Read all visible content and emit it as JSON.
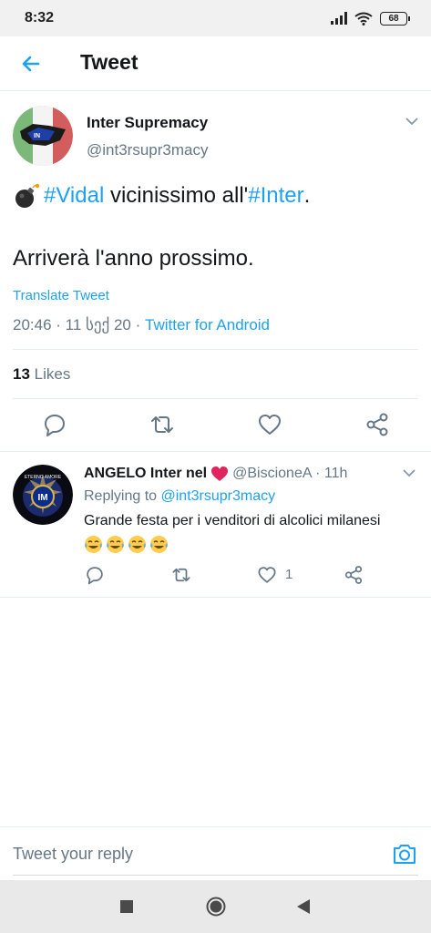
{
  "status_bar": {
    "time": "8:32",
    "battery": "68",
    "icons": [
      "signal-icon",
      "wifi-icon",
      "battery-icon"
    ]
  },
  "header": {
    "title": "Tweet",
    "back_icon": "arrow-left-icon"
  },
  "tweet": {
    "author_name": "Inter Supremacy",
    "author_handle": "@int3rsupr3macy",
    "text_emoji": "bomb-emoji",
    "text_tag1": "#Vidal",
    "text_mid": " vicinissimo all'",
    "text_tag2": "#Inter",
    "text_end": ".",
    "text_line2": "Arriverà l'anno prossimo.",
    "translate_label": "Translate Tweet",
    "timestamp": "20:46 · 11 სექ 20 · ",
    "source": "Twitter for Android",
    "likes_count": "13",
    "likes_label": " Likes",
    "actions": [
      "reply-icon",
      "retweet-icon",
      "like-icon",
      "share-icon"
    ]
  },
  "reply": {
    "name": "ANGELO Inter nel",
    "name_emoji": "red-heart-emoji",
    "handle": "@BiscioneA · 11h",
    "replying_prefix": "Replying to ",
    "replying_to": "@int3rsupr3macy",
    "text": "Grande festa per i venditori di alcolici milanesi",
    "emojis": [
      "tears-of-joy-emoji",
      "tears-of-joy-emoji",
      "tears-of-joy-emoji",
      "tears-of-joy-emoji"
    ],
    "like_count": "1",
    "actions": [
      "reply-icon",
      "retweet-icon",
      "like-icon",
      "share-icon"
    ]
  },
  "compose": {
    "placeholder": "Tweet your reply",
    "camera_icon": "camera-icon"
  },
  "nav": [
    "recents-square-icon",
    "home-circle-icon",
    "back-triangle-icon"
  ],
  "colors": {
    "accent": "#1da1f2",
    "secondary_text": "#657786",
    "primary_text": "#14171a",
    "divider": "#e6ecf0"
  }
}
